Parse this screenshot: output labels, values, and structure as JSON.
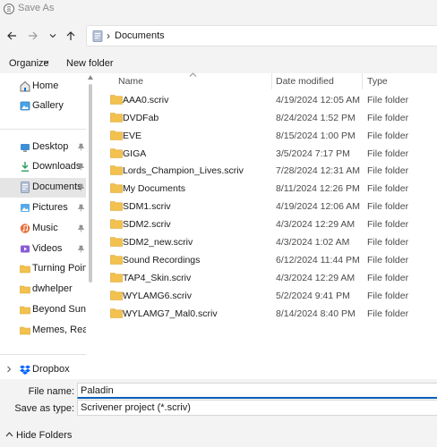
{
  "window": {
    "title": "Save As"
  },
  "nav": {
    "back_icon": "arrow-left-icon",
    "forward_icon": "arrow-right-icon",
    "recent_icon": "chevron-down-icon",
    "up_icon": "arrow-up-icon"
  },
  "address": {
    "path": "Documents"
  },
  "toolbar": {
    "organize_label": "Organize",
    "new_folder_label": "New folder"
  },
  "sidebar": {
    "items": [
      {
        "label": "Home",
        "icon": "home-icon",
        "pinned": false
      },
      {
        "label": "Gallery",
        "icon": "gallery-icon",
        "pinned": false
      },
      {
        "label": "Desktop",
        "icon": "desktop-icon",
        "pinned": true
      },
      {
        "label": "Downloads",
        "icon": "download-icon",
        "pinned": true
      },
      {
        "label": "Documents",
        "icon": "documents-icon",
        "pinned": true,
        "selected": true
      },
      {
        "label": "Pictures",
        "icon": "pictures-icon",
        "pinned": true
      },
      {
        "label": "Music",
        "icon": "music-icon",
        "pinned": true
      },
      {
        "label": "Videos",
        "icon": "videos-icon",
        "pinned": true
      },
      {
        "label": "Turning Point",
        "icon": "folder-icon",
        "pinned": false
      },
      {
        "label": "dwhelper",
        "icon": "folder-icon",
        "pinned": false
      },
      {
        "label": "Beyond Sunset (",
        "icon": "folder-icon",
        "pinned": false
      },
      {
        "label": "Memes, Reactio",
        "icon": "folder-icon",
        "pinned": false
      },
      {
        "label": "Dropbox",
        "icon": "dropbox-icon",
        "pinned": false
      }
    ]
  },
  "columns": {
    "name": "Name",
    "date": "Date modified",
    "type": "Type"
  },
  "files": [
    {
      "name": "AAA0.scriv",
      "date": "4/19/2024 12:05 AM",
      "type": "File folder"
    },
    {
      "name": "DVDFab",
      "date": "8/24/2024 1:52 PM",
      "type": "File folder"
    },
    {
      "name": "EVE",
      "date": "8/15/2024 1:00 PM",
      "type": "File folder"
    },
    {
      "name": "GIGA",
      "date": "3/5/2024 7:17 PM",
      "type": "File folder"
    },
    {
      "name": "Lords_Champion_Lives.scriv",
      "date": "7/28/2024 12:31 AM",
      "type": "File folder"
    },
    {
      "name": "My Documents",
      "date": "8/11/2024 12:26 PM",
      "type": "File folder"
    },
    {
      "name": "SDM1.scriv",
      "date": "4/19/2024 12:06 AM",
      "type": "File folder"
    },
    {
      "name": "SDM2.scriv",
      "date": "4/3/2024 12:29 AM",
      "type": "File folder"
    },
    {
      "name": "SDM2_new.scriv",
      "date": "4/3/2024 1:02 AM",
      "type": "File folder"
    },
    {
      "name": "Sound Recordings",
      "date": "6/12/2024 11:44 PM",
      "type": "File folder"
    },
    {
      "name": "TAP4_Skin.scriv",
      "date": "4/3/2024 12:29 AM",
      "type": "File folder"
    },
    {
      "name": "WYLAMG6.scriv",
      "date": "5/2/2024 9:41 PM",
      "type": "File folder"
    },
    {
      "name": "WYLAMG7_Mal0.scriv",
      "date": "8/14/2024 8:40 PM",
      "type": "File folder"
    }
  ],
  "form": {
    "file_name_label": "File name:",
    "file_name_value": "Paladin",
    "save_type_label": "Save as type:",
    "save_type_value": "Scrivener project (*.scriv)"
  },
  "footer": {
    "hide_folders_label": "Hide Folders"
  },
  "colors": {
    "accent": "#005fb8",
    "folder": "#f2c14e",
    "selected": "#e5e5e5"
  }
}
